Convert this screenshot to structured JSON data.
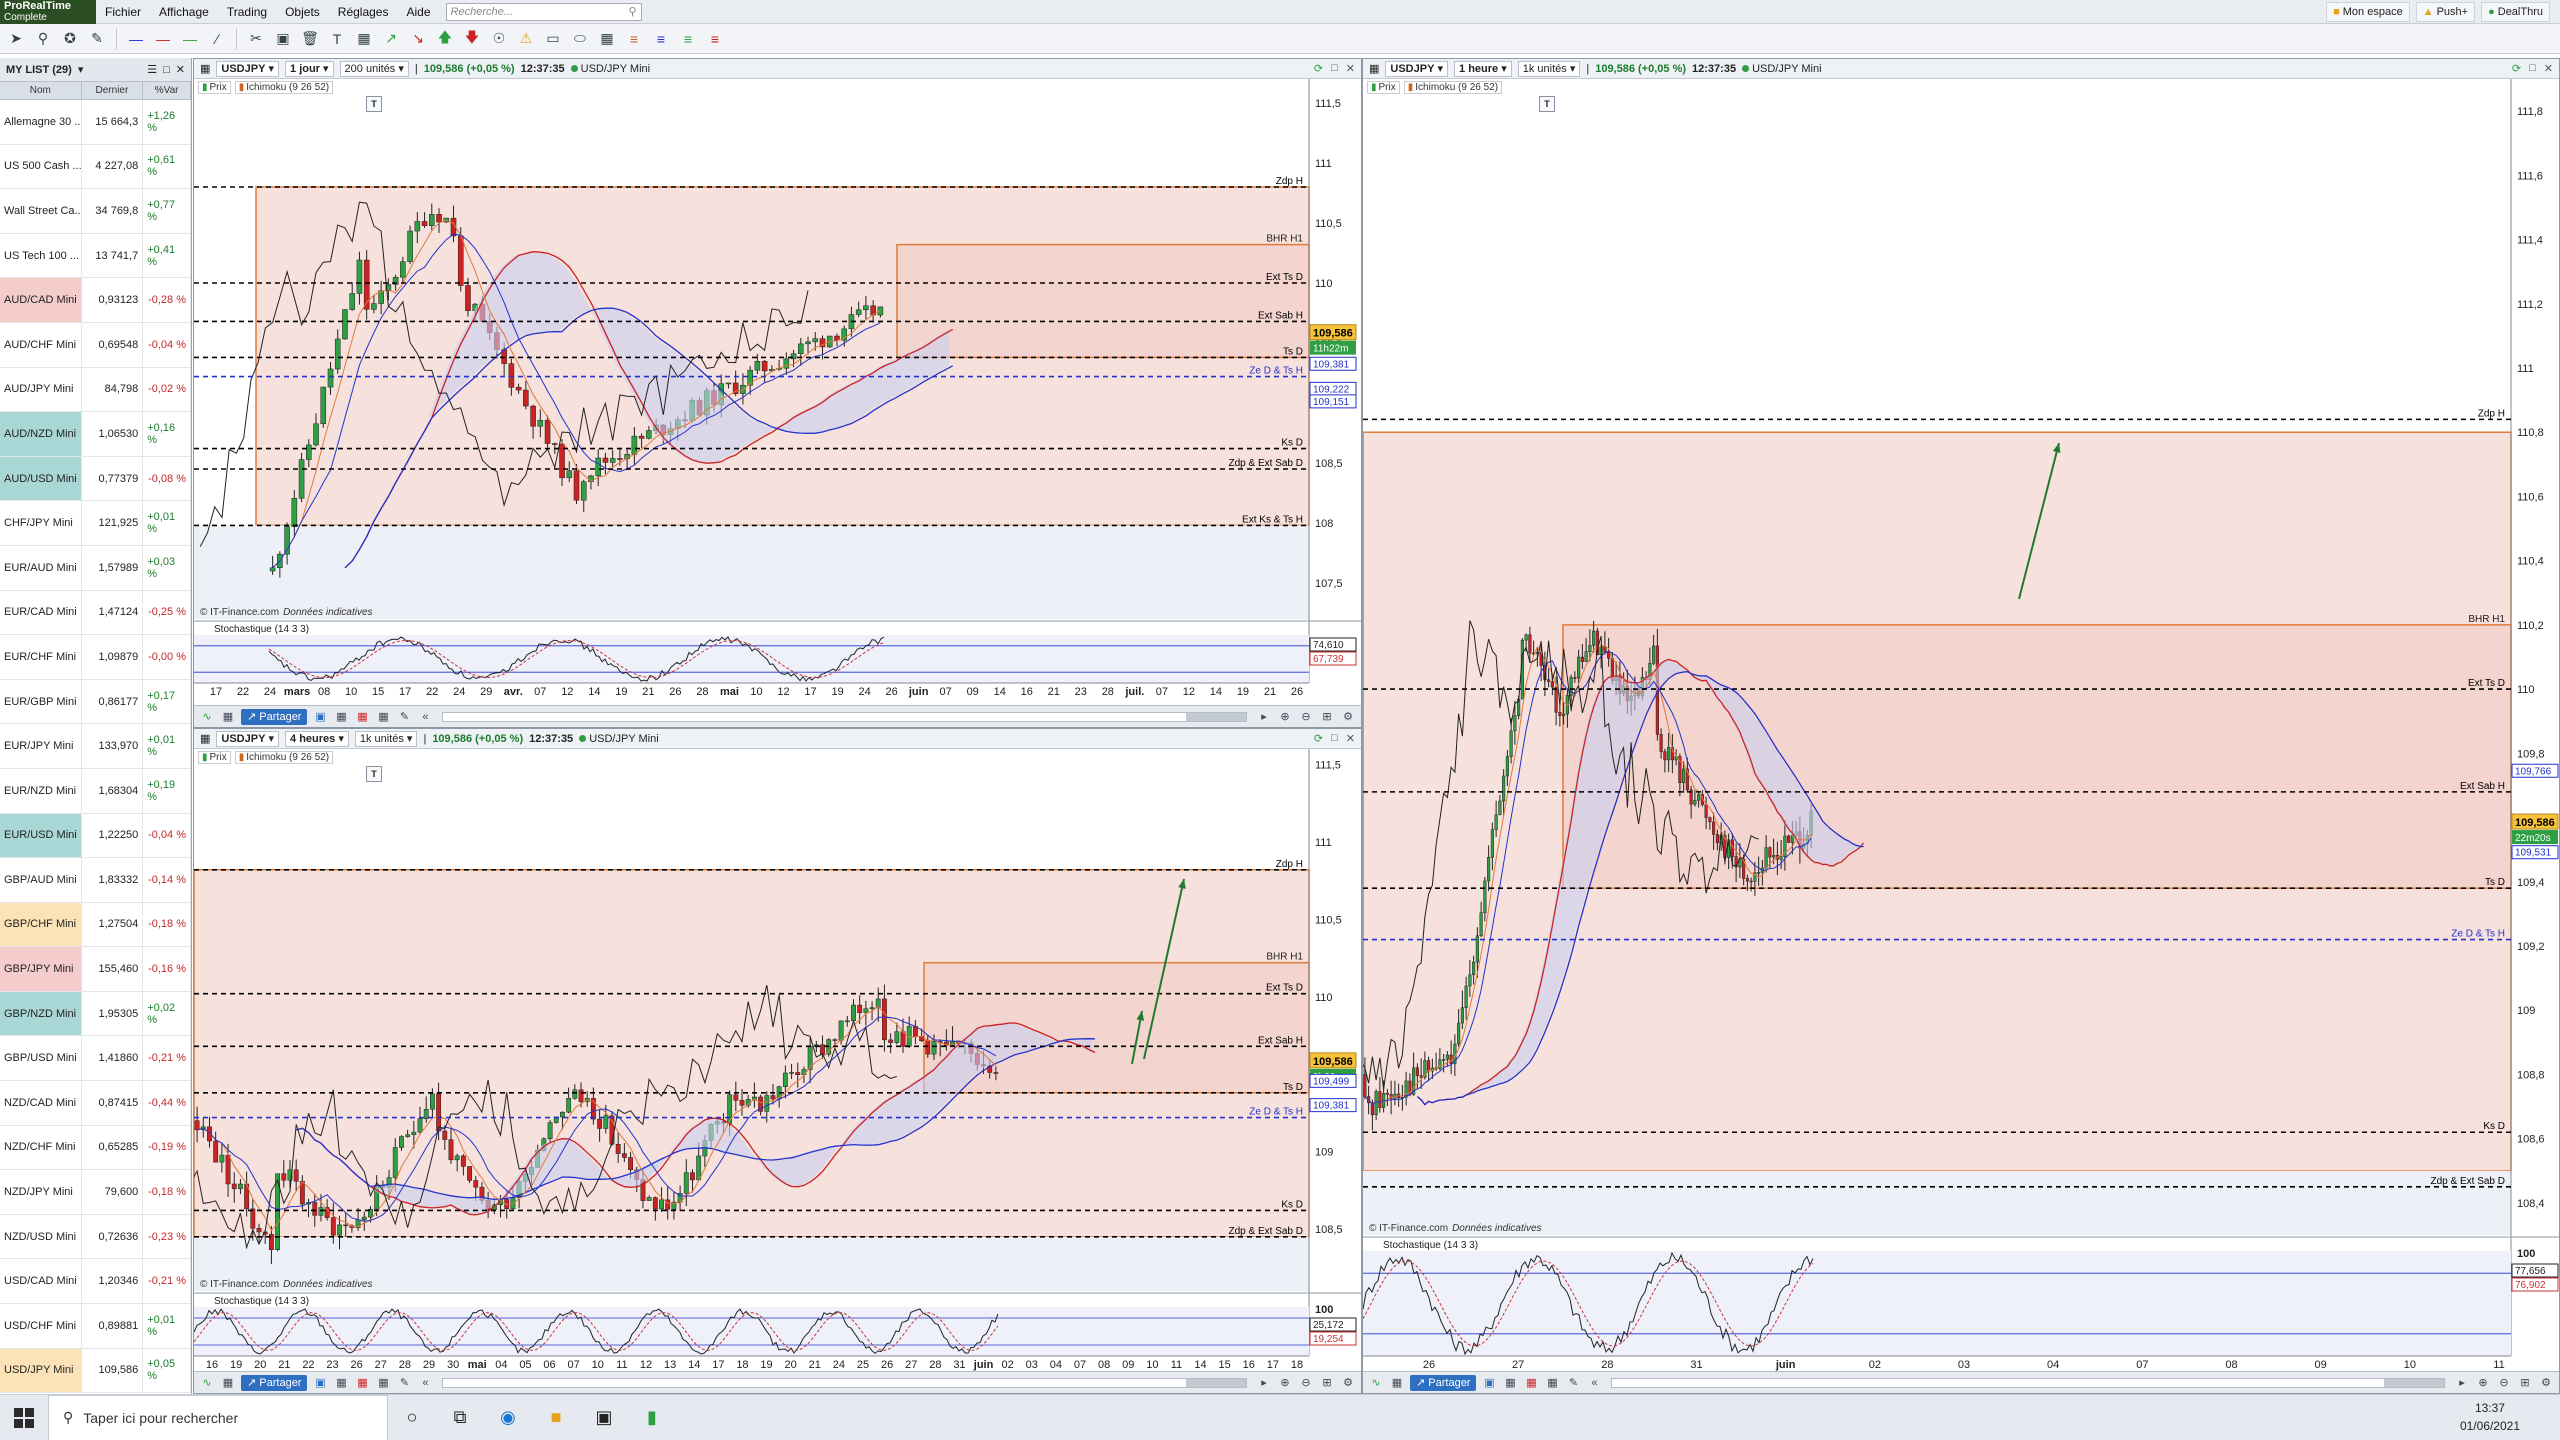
{
  "app": {
    "name": "ProRealTime",
    "edition": "Complete"
  },
  "menu": [
    "Fichier",
    "Affichage",
    "Trading",
    "Objets",
    "Réglages",
    "Aide"
  ],
  "search": {
    "placeholder": "Recherche..."
  },
  "topright": {
    "account": "Mon espace",
    "push": "Push+",
    "dealthru": "DealThru"
  },
  "watchlist": {
    "title": "MY LIST (29)",
    "columns": {
      "name": "Nom",
      "last": "Dernier",
      "var": "%Var"
    },
    "rows": [
      {
        "name": "Allemagne 30 ...",
        "last": "15 664,3",
        "var": "+1,26 %",
        "tone": "plain"
      },
      {
        "name": "US 500 Cash ...",
        "last": "4 227,08",
        "var": "+0,61 %",
        "tone": "plain"
      },
      {
        "name": "Wall Street Ca...",
        "last": "34 769,8",
        "var": "+0,77 %",
        "tone": "plain"
      },
      {
        "name": "US Tech 100 ...",
        "last": "13 741,7",
        "var": "+0,41 %",
        "tone": "plain"
      },
      {
        "name": "AUD/CAD Mini",
        "last": "0,93123",
        "var": "-0,28 %",
        "tone": "neg"
      },
      {
        "name": "AUD/CHF Mini",
        "last": "0,69548",
        "var": "-0,04 %",
        "tone": "plain"
      },
      {
        "name": "AUD/JPY Mini",
        "last": "84,798",
        "var": "-0,02 %",
        "tone": "plain"
      },
      {
        "name": "AUD/NZD Mini",
        "last": "1,06530",
        "var": "+0,16 %",
        "tone": "teal"
      },
      {
        "name": "AUD/USD Mini",
        "last": "0,77379",
        "var": "-0,08 %",
        "tone": "teal"
      },
      {
        "name": "CHF/JPY Mini",
        "last": "121,925",
        "var": "+0,01 %",
        "tone": "plain"
      },
      {
        "name": "EUR/AUD Mini",
        "last": "1,57989",
        "var": "+0,03 %",
        "tone": "plain"
      },
      {
        "name": "EUR/CAD Mini",
        "last": "1,47124",
        "var": "-0,25 %",
        "tone": "plain"
      },
      {
        "name": "EUR/CHF Mini",
        "last": "1,09879",
        "var": "-0,00 %",
        "tone": "plain"
      },
      {
        "name": "EUR/GBP Mini",
        "last": "0,86177",
        "var": "+0,17 %",
        "tone": "plain"
      },
      {
        "name": "EUR/JPY Mini",
        "last": "133,970",
        "var": "+0,01 %",
        "tone": "plain"
      },
      {
        "name": "EUR/NZD Mini",
        "last": "1,68304",
        "var": "+0,19 %",
        "tone": "plain"
      },
      {
        "name": "EUR/USD Mini",
        "last": "1,22250",
        "var": "-0,04 %",
        "tone": "teal"
      },
      {
        "name": "GBP/AUD Mini",
        "last": "1,83332",
        "var": "-0,14 %",
        "tone": "plain"
      },
      {
        "name": "GBP/CHF Mini",
        "last": "1,27504",
        "var": "-0,18 %",
        "tone": "orange"
      },
      {
        "name": "GBP/JPY Mini",
        "last": "155,460",
        "var": "-0,16 %",
        "tone": "neg"
      },
      {
        "name": "GBP/NZD Mini",
        "last": "1,95305",
        "var": "+0,02 %",
        "tone": "teal"
      },
      {
        "name": "GBP/USD Mini",
        "last": "1,41860",
        "var": "-0,21 %",
        "tone": "plain"
      },
      {
        "name": "NZD/CAD Mini",
        "last": "0,87415",
        "var": "-0,44 %",
        "tone": "plain"
      },
      {
        "name": "NZD/CHF Mini",
        "last": "0,65285",
        "var": "-0,19 %",
        "tone": "plain"
      },
      {
        "name": "NZD/JPY Mini",
        "last": "79,600",
        "var": "-0,18 %",
        "tone": "plain"
      },
      {
        "name": "NZD/USD Mini",
        "last": "0,72636",
        "var": "-0,23 %",
        "tone": "plain"
      },
      {
        "name": "USD/CAD Mini",
        "last": "1,20346",
        "var": "-0,21 %",
        "tone": "plain"
      },
      {
        "name": "USD/CHF Mini",
        "last": "0,89881",
        "var": "+0,01 %",
        "tone": "plain"
      },
      {
        "name": "USD/JPY Mini",
        "last": "109,586",
        "var": "+0,05 %",
        "tone": "orange"
      }
    ]
  },
  "common": {
    "legend_price": "Prix",
    "legend_ichimoku": "Ichimoku (9 26 52)",
    "stochastic": "Stochastique (14 3 3)",
    "source": "© IT-Finance.com",
    "source_note": "Données indicatives",
    "share": "Partager",
    "quote": "109,586 (+0,05 %)",
    "time": "12:37:35",
    "instrument": "USD/JPY Mini",
    "ticker": "USDJPY",
    "tbox": "T",
    "last_price": "109,586"
  },
  "panels": [
    {
      "interval": "1 jour",
      "units": "200 unités",
      "price_axis": [
        "111,5",
        "111",
        "110,5",
        "110",
        "109,5",
        "109",
        "108,5",
        "108",
        "107,5"
      ],
      "timer": "11h22m",
      "level_tags": [
        "109,381",
        "109,222",
        "109,151"
      ],
      "stoch_tags": [
        "74,610",
        "67,739"
      ],
      "xaxis": [
        "17",
        "22",
        "24",
        "mars",
        "08",
        "10",
        "15",
        "17",
        "22",
        "24",
        "29",
        "avr.",
        "07",
        "12",
        "14",
        "19",
        "21",
        "26",
        "28",
        "mai",
        "10",
        "12",
        "17",
        "19",
        "24",
        "26",
        "juin",
        "07",
        "09",
        "14",
        "16",
        "21",
        "23",
        "28",
        "juil.",
        "07",
        "12",
        "14",
        "19",
        "21",
        "26"
      ],
      "levels": [
        {
          "label": "Zdp H",
          "price": 110.8,
          "color": "#000"
        },
        {
          "label": "Ext Ts D",
          "price": 110.0,
          "color": "#000"
        },
        {
          "label": "Ext Sab H",
          "price": 109.68,
          "color": "#000"
        },
        {
          "label": "Ts D",
          "price": 109.38,
          "color": "#000"
        },
        {
          "label": "Ze D & Ts H",
          "price": 109.22,
          "color": "#2233cc"
        },
        {
          "label": "Ks D",
          "price": 108.62,
          "color": "#000"
        },
        {
          "label": "Zdp & Ext Sab D",
          "price": 108.45,
          "color": "#000"
        },
        {
          "label": "Ext Ks & Ts H",
          "price": 107.98,
          "color": "#000"
        }
      ],
      "bhr": "BHR H1"
    },
    {
      "interval": "4 heures",
      "units": "1k unités",
      "price_axis": [
        "111,5",
        "111",
        "110,5",
        "110",
        "109,5",
        "109",
        "108,5"
      ],
      "timer": "3h22m",
      "level_tags": [
        "109,499",
        "109,381"
      ],
      "stoch_tags": [
        "25,172",
        "19,254"
      ],
      "stoch_top": "100",
      "xaxis": [
        "16",
        "19",
        "20",
        "21",
        "22",
        "23",
        "26",
        "27",
        "28",
        "29",
        "30",
        "mai",
        "04",
        "05",
        "06",
        "07",
        "10",
        "11",
        "12",
        "13",
        "14",
        "17",
        "18",
        "19",
        "20",
        "21",
        "24",
        "25",
        "26",
        "27",
        "28",
        "31",
        "juin",
        "02",
        "03",
        "04",
        "07",
        "08",
        "09",
        "10",
        "11",
        "14",
        "15",
        "16",
        "17",
        "18"
      ],
      "levels": [
        {
          "label": "Zdp H",
          "price": 110.82,
          "color": "#000"
        },
        {
          "label": "Ext Ts D",
          "price": 110.02,
          "color": "#000"
        },
        {
          "label": "Ext Sab H",
          "price": 109.68,
          "color": "#000"
        },
        {
          "label": "Ts D",
          "price": 109.38,
          "color": "#000"
        },
        {
          "label": "Ze D & Ts H",
          "price": 109.22,
          "color": "#2233cc"
        },
        {
          "label": "Ks D",
          "price": 108.62,
          "color": "#000"
        },
        {
          "label": "Zdp & Ext Sab D",
          "price": 108.45,
          "color": "#000"
        }
      ],
      "bhr": "BHR H1"
    },
    {
      "interval": "1 heure",
      "units": "1k unités",
      "price_axis": [
        "111,8",
        "111,6",
        "111,4",
        "111,2",
        "111",
        "110,8",
        "110,6",
        "110,4",
        "110,2",
        "110",
        "109,8",
        "109,6",
        "109,4",
        "109,2",
        "109",
        "108,8",
        "108,6",
        "108,4"
      ],
      "timer": "22m20s",
      "level_tags": [
        "109,766",
        "109,531"
      ],
      "stoch_tags": [
        "77,656",
        "76,902"
      ],
      "stoch_top": "100",
      "xaxis": [
        "26",
        "27",
        "28",
        "31",
        "juin",
        "02",
        "03",
        "04",
        "07",
        "08",
        "09",
        "10",
        "11"
      ],
      "levels": [
        {
          "label": "Zdp H",
          "price": 110.84,
          "color": "#000"
        },
        {
          "label": "Ext Ts D",
          "price": 110.0,
          "color": "#000"
        },
        {
          "label": "Ext Sab H",
          "price": 109.68,
          "color": "#000"
        },
        {
          "label": "Ts D",
          "price": 109.38,
          "color": "#000"
        },
        {
          "label": "Ze D & Ts H",
          "price": 109.22,
          "color": "#2233cc"
        },
        {
          "label": "Ks D",
          "price": 108.62,
          "color": "#000"
        },
        {
          "label": "Zdp & Ext Sab D",
          "price": 108.45,
          "color": "#000"
        }
      ],
      "bhr": "BHR H1"
    }
  ],
  "taskbar": {
    "search": "Taper ici pour rechercher",
    "time": "13:37",
    "date": "01/06/2021"
  },
  "colors": {
    "up": "#2ea043",
    "down": "#cc2222",
    "band": "#f3d9d4",
    "cloud_blue": "#c9d0f0",
    "cloud_red": "#f3c4c4",
    "accent": "#2f6fc2"
  }
}
